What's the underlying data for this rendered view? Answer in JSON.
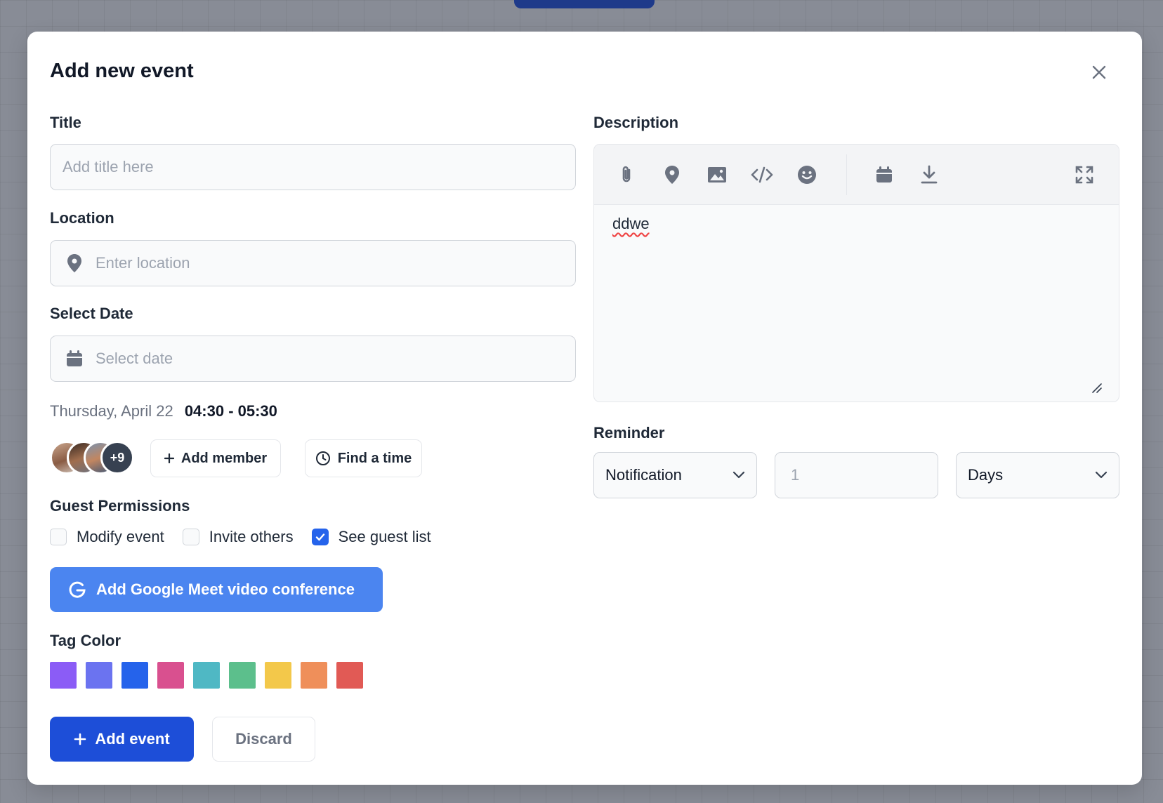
{
  "modal": {
    "title": "Add new event",
    "close_icon": "close-icon"
  },
  "form": {
    "title_label": "Title",
    "title_placeholder": "Add title here",
    "location_label": "Location",
    "location_placeholder": "Enter location",
    "location_icon": "map-pin-icon",
    "date_label": "Select Date",
    "date_placeholder": "Select date",
    "date_icon": "calendar-icon",
    "day_text": "Thursday, April 22",
    "time_text": "04:30 - 05:30"
  },
  "members": {
    "more_count": "+9",
    "add_member_label": "Add member",
    "find_time_label": "Find a time"
  },
  "guest_permissions": {
    "label": "Guest Permissions",
    "options": [
      {
        "label": "Modify event",
        "checked": false
      },
      {
        "label": "Invite others",
        "checked": false
      },
      {
        "label": "See guest list",
        "checked": true
      }
    ]
  },
  "meet": {
    "label": "Add Google Meet video conference",
    "icon": "google-icon"
  },
  "tag_color": {
    "label": "Tag Color",
    "colors": [
      "#8b5cf6",
      "#6b73f0",
      "#2563eb",
      "#d9508f",
      "#4fb8c4",
      "#5cbf8c",
      "#f3c84a",
      "#ef8f5a",
      "#e15a55"
    ]
  },
  "actions": {
    "add_event_label": "Add event",
    "discard_label": "Discard"
  },
  "description": {
    "label": "Description",
    "text": "ddwe",
    "toolbar_icons": [
      "paperclip-icon",
      "map-pin-icon",
      "image-icon",
      "code-icon",
      "emoji-icon",
      "calendar-icon",
      "download-icon",
      "fullscreen-icon"
    ]
  },
  "reminder": {
    "label": "Reminder",
    "type_value": "Notification",
    "amount_placeholder": "1",
    "unit_value": "Days"
  },
  "colors": {
    "primary": "#1d4ed8",
    "meet_button": "#4b85f0",
    "checked": "#2563eb"
  }
}
